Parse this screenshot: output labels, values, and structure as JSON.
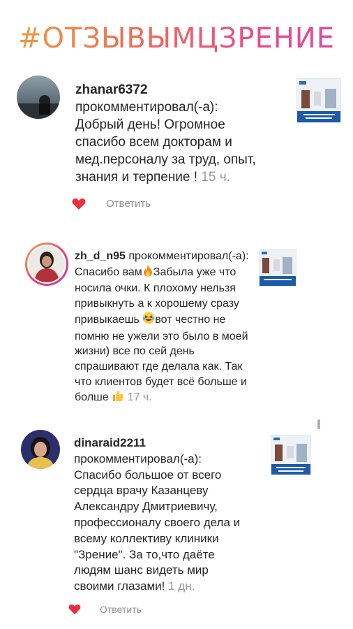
{
  "header": {
    "hashtag": "#ОТЗЫВЫМЦЗРЕНИЕ"
  },
  "colors": {
    "gradient_start": "#f0a03a",
    "gradient_end": "#d94aa8",
    "heart": "#e8303f",
    "muted": "#8e8e8e"
  },
  "comments": [
    {
      "username": "zhanar6372",
      "action": "прокомментировал(-а):",
      "text": "Добрый день!  Огромное спасибо всем  докторам и мед.персоналу за труд, опыт, знания и терпение !",
      "time": "15 ч.",
      "reply": "Ответить",
      "liked": true
    },
    {
      "username": "zh_d_n95",
      "action": "прокомментировал(-а):",
      "text_1": "Спасибо вам",
      "text_2": "Забыла уже что носила очки. К плохому нельзя привыкнуть а к хорошему сразу привыкаешь",
      "text_3": "вот честно не помню не ужели это было в моей жизни) все по сей день спрашивают где делала как. Так что клиентов будет всё больше и болше",
      "time": "17 ч.",
      "emoji_fire": "fire-icon",
      "emoji_laugh": "laughing-face-icon",
      "emoji_thumb": "thumbs-up-icon"
    },
    {
      "username": "dinaraid2211",
      "action": "прокомментировал(-а):",
      "text": "Спасибо большое от всего сердца врачу Казанцеву Александру Дмитриевичу, профессионалу своего дела и всему коллективу клиники \"Зрение\". За то,что  даёте людям шанс видеть мир своими глазами!",
      "time": "1 дн.",
      "reply": "Ответить",
      "liked": true
    }
  ]
}
